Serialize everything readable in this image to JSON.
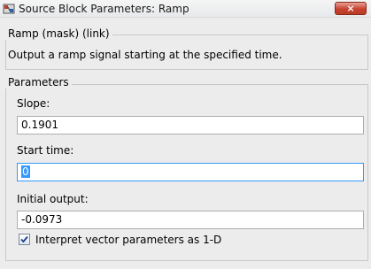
{
  "window": {
    "title": "Source Block Parameters: Ramp",
    "close_label": "×"
  },
  "mask_group": {
    "legend": "Ramp (mask) (link)",
    "description": "Output a ramp signal starting at the specified time."
  },
  "parameters_group": {
    "legend": "Parameters",
    "slope": {
      "label": "Slope:",
      "value": "0.1901"
    },
    "start_time": {
      "label": "Start time:",
      "value": "0"
    },
    "initial_output": {
      "label": "Initial output:",
      "value": "-0.0973"
    },
    "interpret_vector": {
      "label": "Interpret vector parameters as 1-D",
      "checked": true
    }
  },
  "colors": {
    "focus_border": "#3399ff",
    "selection": "#3399ff",
    "close_button": "#c7432f"
  }
}
